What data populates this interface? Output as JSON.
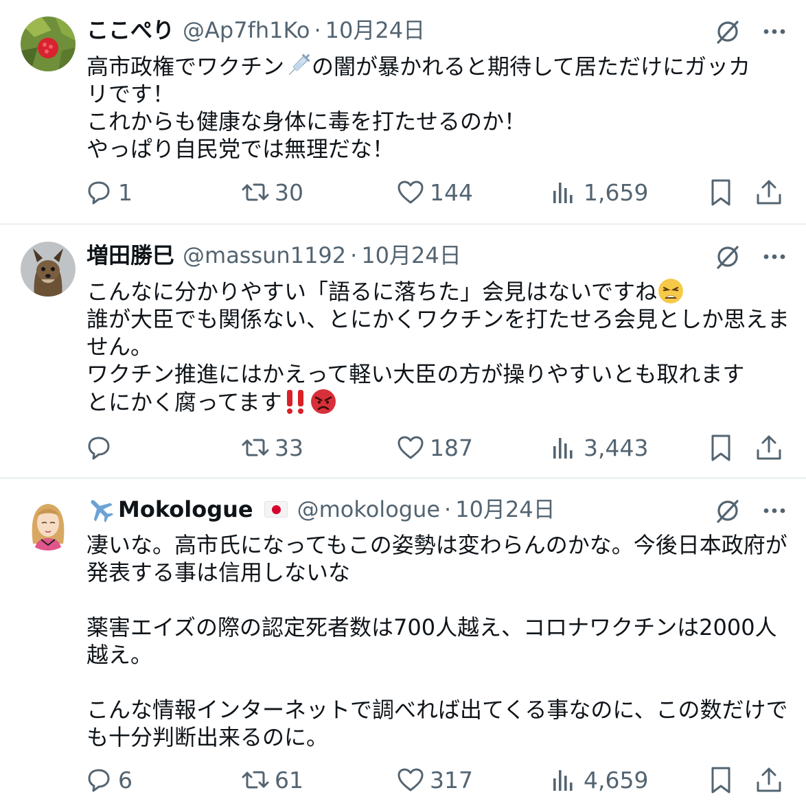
{
  "posts": [
    {
      "name": "ここぺり",
      "handle": "@Ap7fh1Ko",
      "separator": "·",
      "date": "10月24日",
      "text_line1": "高市政権でワクチン",
      "text_line1_rest": "の闇が暴かれると期待して居ただけにガッカ",
      "text_rest": "リです！\nこれからも健康な身体に毒を打たせるのか！\nやっぱり自民党では無理だな！",
      "replies": "1",
      "reposts": "30",
      "likes": "144",
      "views": "1,659",
      "avatar_icon": "raspberry-avatar",
      "inline_emoji": "syringe-emoji"
    },
    {
      "name": "増田勝巳",
      "handle": "@massun1192",
      "separator": "·",
      "date": "10月24日",
      "text_a": "こんなに分かりやすい「語るに落ちた」会見はないですね",
      "text_b": "誰が大臣でも関係ない、とにかくワクチンを打たせろ会見としか思えません。\nワクチン推進にはかえって軽い大臣の方が操りやすいとも取れます\nとにかく腐ってます",
      "replies": "",
      "reposts": "33",
      "likes": "187",
      "views": "3,443",
      "avatar_icon": "dog-avatar",
      "inline_emoji": [
        "weary-face-emoji",
        "double-exclamation-emoji",
        "angry-face-emoji"
      ]
    },
    {
      "name": "Mokologue",
      "handle": "@mokologue",
      "separator": "·",
      "date": "10月24日",
      "text": "凄いな。高市氏になってもこの姿勢は変わらんのかな。今後日本政府が発表する事は信用しないな\n\n薬害エイズの際の認定死者数は700人越え、コロナワクチンは2000人越え。\n\nこんな情報インターネットで調べれば出てくる事なのに、この数だけでも十分判断出来るのに。",
      "replies": "6",
      "reposts": "61",
      "likes": "317",
      "views": "4,659",
      "avatar_icon": "illustrated-woman-avatar",
      "name_prefix_icon": "airplane-emoji",
      "name_suffix_icon": "japan-flag-emoji"
    }
  ],
  "colors": {
    "text": "#0f1419",
    "secondary": "#536471",
    "divider": "#eff3f4"
  },
  "icons": [
    "reply-icon",
    "repost-icon",
    "like-icon",
    "views-icon",
    "bookmark-icon",
    "share-icon",
    "grok-icon",
    "more-icon"
  ]
}
